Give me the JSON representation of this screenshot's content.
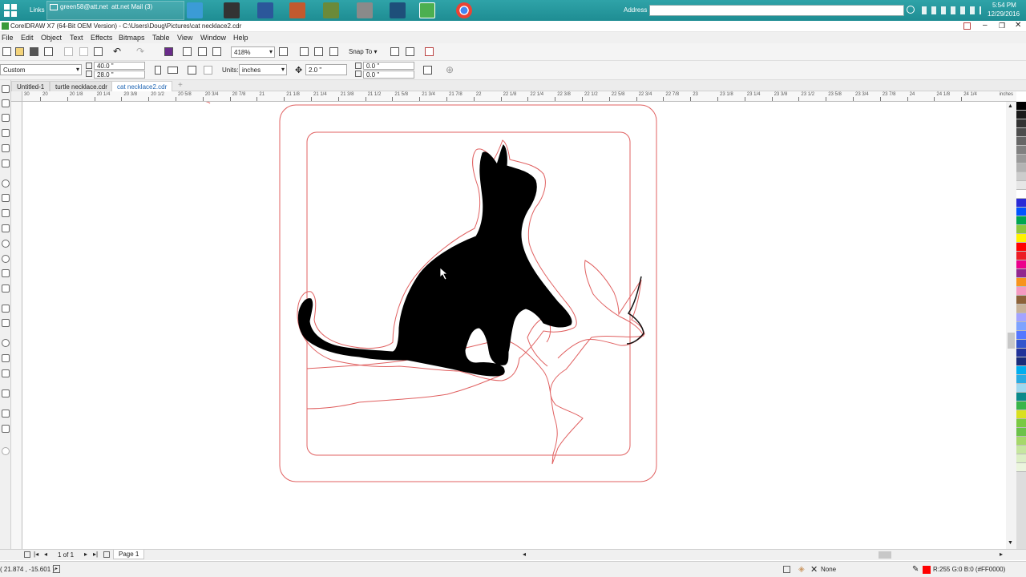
{
  "taskbar": {
    "links_label": "Links",
    "email": "green58@att.net",
    "mail_label": "att.net Mail (3)",
    "address_label": "Address",
    "time": "5:54 PM",
    "date": "12/29/2016"
  },
  "window": {
    "title": "CorelDRAW X7 (64-Bit OEM Version) - C:\\Users\\Doug\\Pictures\\cat necklace2.cdr"
  },
  "menu": [
    "File",
    "Edit",
    "Object",
    "Text",
    "Effects",
    "Bitmaps",
    "Table",
    "View",
    "Window",
    "Help"
  ],
  "toolbar": {
    "zoom": "418%",
    "snap_to": "Snap To",
    "page_preset": "Custom",
    "width": "40.0 \"",
    "height": "28.0 \"",
    "units_label": "Units:",
    "units_value": "inches",
    "nudge": "2.0 \"",
    "dup_x": "0.0 \"",
    "dup_y": "0.0 \""
  },
  "tabs": [
    {
      "label": "Untitled-1",
      "active": false
    },
    {
      "label": "turtle necklace.cdr",
      "active": false
    },
    {
      "label": "cat necklace2.cdr",
      "active": true
    }
  ],
  "ruler": {
    "ticks": [
      "20",
      "20 1/8",
      "20 1/4",
      "20 3/8",
      "20 1/2",
      "20 5/8",
      "20 3/4",
      "20 7/8",
      "21",
      "21 1/8",
      "21 1/4",
      "21 3/8",
      "21 1/2",
      "21 5/8",
      "21 3/4",
      "21 7/8",
      "22",
      "22 1/8",
      "22 1/4",
      "22 3/8",
      "22 1/2",
      "22 5/8",
      "22 3/4",
      "22 7/8",
      "23",
      "23 1/8",
      "23 1/4",
      "23 3/8",
      "23 1/2",
      "23 5/8",
      "23 3/4",
      "23 7/8",
      "24",
      "24 1/8",
      "24 1/4"
    ],
    "first_tick": "30",
    "units": "inches"
  },
  "page_nav": {
    "page_count": "1 of 1",
    "page_tab": "Page 1"
  },
  "status": {
    "coords": "( 21.874 , -15.601 )",
    "fill": "None",
    "outline": "R:255 G:0 B:0 (#FF0000)"
  },
  "colors": {
    "outline_red": "#e06060",
    "palette": [
      "#000000",
      "#1a1a1a",
      "#333333",
      "#4d4d4d",
      "#666666",
      "#808080",
      "#999999",
      "#b3b3b3",
      "#cccccc",
      "#e6e6e6",
      "#ffffff",
      "#2b2bd6",
      "#0055ff",
      "#00a651",
      "#8dc63f",
      "#fff200",
      "#ff0000",
      "#ed1c24",
      "#ec008c",
      "#92278f",
      "#f7941d",
      "#f49ac1",
      "#8c6239",
      "#c7b299",
      "#a3a3ff",
      "#7fa3ff",
      "#5577ff",
      "#3355cc",
      "#223399",
      "#1a2d7a",
      "#00aeef",
      "#29abe2",
      "#9fd8ef",
      "#0a8a8a",
      "#39b54a",
      "#d9e021",
      "#7ac943",
      "#6cc24a",
      "#a6d86b",
      "#c6e6a0",
      "#dcefc6",
      "#ebf5de"
    ]
  }
}
